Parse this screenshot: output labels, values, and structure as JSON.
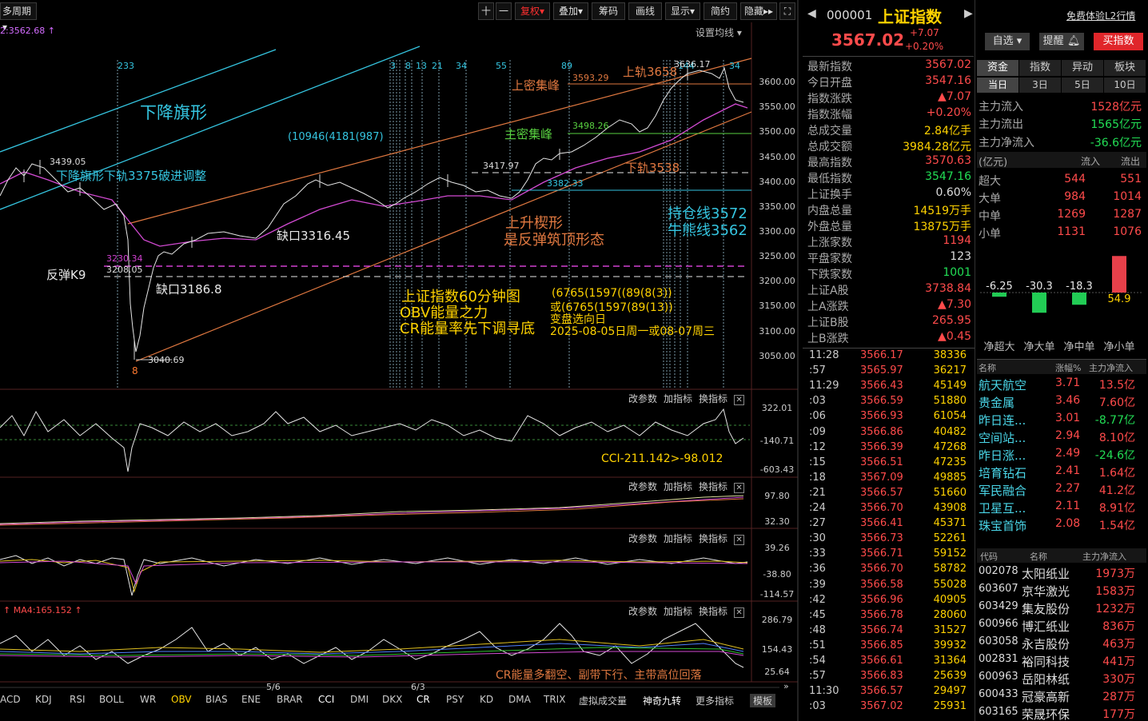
{
  "toolbar": {
    "period": "多周期",
    "tools": [
      "十",
      "一",
      "复权",
      "叠加",
      "筹码",
      "画线",
      "显示",
      "简约",
      "隐藏"
    ],
    "settings": "设置均线",
    "ma_line": "2:3562.68"
  },
  "chart": {
    "price_axis": [
      "3600.00",
      "3550.00",
      "3500.00",
      "3450.00",
      "3400.00",
      "3350.00",
      "3300.00",
      "3250.00",
      "3200.00",
      "3150.00",
      "3100.00",
      "3050.00"
    ],
    "top_numbers": [
      "233",
      "3",
      "8",
      "13",
      "21",
      "34",
      "55",
      "89",
      "144",
      "34"
    ],
    "annotations": {
      "desc_flag": "下降旗形",
      "flag_break": "下降旗形下轨3375破进调整",
      "fib_triple": "(10946(4181(987)",
      "high_3439": "3439.05",
      "upper_peak": "上密集峰",
      "mid_peak": "主密集峰",
      "p3593": "3593.29",
      "p3498": "3498.26",
      "upper_rail": "上轨3658",
      "lower_rail": "下轨3538",
      "p3636": "3636.17",
      "p3417": "3417.97",
      "p3382": "3382.33",
      "wedge1": "上升楔形",
      "wedge2": "是反弹筑顶形态",
      "hold_line": "持仓线3572",
      "bull_bear": "牛熊线3562",
      "gap1": "缺口3316.45",
      "gap2": "缺口3186.8",
      "p3230": "3230.34",
      "p3208": "3208.05",
      "k9": "反弹K9",
      "low_3040": "3040.69",
      "low_digit": "8",
      "title1": "上证指数60分钟图",
      "title2": "OBV能量之力",
      "title3": "CR能量率先下调寻底",
      "seq1": "(6765(1597((89(8(3))",
      "seq2": "或(6765(1597(89(13))",
      "seq3": "变盘选向日",
      "seq4": "2025-08-05日周一或08-07周三",
      "cci_val": "CCI-211.142>-98.012",
      "cr_note": "CR能量多翻空、副带下行、主带高位回落",
      "ma4": "MA4:165.152"
    },
    "sub1_axis": [
      "322.01",
      "-140.71",
      "-603.43"
    ],
    "sub2_axis": [
      "97.80",
      "32.30"
    ],
    "sub3_axis": [
      "39.26",
      "-38.80",
      "-114.57"
    ],
    "sub4_axis": [
      "286.79",
      "154.43",
      "25.64"
    ],
    "sub_tools": [
      "改参数",
      "加指标",
      "换指标"
    ],
    "dates": [
      "5/6",
      "6/3"
    ],
    "bottom_tabs": [
      "ACD",
      "KDJ",
      "RSI",
      "BOLL",
      "WR",
      "OBV",
      "BIAS",
      "ENE",
      "BRAR",
      "CCI",
      "DMI",
      "DKX",
      "CR",
      "PSY",
      "KD",
      "DMA",
      "TRIX",
      "虚拟成交量",
      "神奇九转",
      "更多指标",
      "模板"
    ]
  },
  "quote": {
    "code": "000001",
    "name": "上证指数",
    "promo": "免费体验L2行情",
    "price": "3567.02",
    "change": "+7.07",
    "pct": "+0.20%",
    "btn_fav": "自选",
    "btn_alert": "提醒",
    "btn_buy": "买指数",
    "stats": [
      [
        "最新指数",
        "3567.02"
      ],
      [
        "今日开盘",
        "3547.16"
      ],
      [
        "指数涨跌",
        "▲7.07"
      ],
      [
        "指数涨幅",
        "+0.20%"
      ],
      [
        "总成交量",
        "2.84亿手"
      ],
      [
        "总成交额",
        "3984.28亿元"
      ],
      [
        "最高指数",
        "3570.63"
      ],
      [
        "最低指数",
        "3547.16"
      ],
      [
        "上证换手",
        "0.60%"
      ],
      [
        "内盘总量",
        "14519万手"
      ],
      [
        "外盘总量",
        "13875万手"
      ],
      [
        "上涨家数",
        "1194"
      ],
      [
        "平盘家数",
        "123"
      ],
      [
        "下跌家数",
        "1001"
      ],
      [
        "上证A股",
        "3738.84"
      ],
      [
        "上A涨跌",
        "▲7.30"
      ],
      [
        "上证B股",
        "265.95"
      ],
      [
        "上B涨跌",
        "▲0.45"
      ]
    ],
    "ticks": [
      [
        "11:28",
        "3566.17",
        "38336"
      ],
      [
        ":57",
        "3565.97",
        "36217"
      ],
      [
        "11:29",
        "3566.43",
        "45149"
      ],
      [
        ":03",
        "3566.59",
        "51880"
      ],
      [
        ":06",
        "3566.93",
        "61054"
      ],
      [
        ":09",
        "3566.86",
        "40482"
      ],
      [
        ":12",
        "3566.39",
        "47268"
      ],
      [
        ":15",
        "3566.51",
        "47235"
      ],
      [
        ":18",
        "3567.09",
        "49885"
      ],
      [
        ":21",
        "3566.57",
        "51660"
      ],
      [
        ":24",
        "3566.70",
        "43908"
      ],
      [
        ":27",
        "3566.41",
        "45371"
      ],
      [
        ":30",
        "3566.73",
        "52261"
      ],
      [
        ":33",
        "3566.71",
        "59152"
      ],
      [
        ":36",
        "3566.70",
        "58782"
      ],
      [
        ":39",
        "3566.58",
        "55028"
      ],
      [
        ":42",
        "3566.96",
        "40905"
      ],
      [
        ":45",
        "3566.78",
        "28060"
      ],
      [
        ":48",
        "3566.74",
        "31527"
      ],
      [
        ":51",
        "3566.85",
        "39932"
      ],
      [
        ":54",
        "3566.61",
        "31364"
      ],
      [
        ":57",
        "3566.83",
        "25639"
      ],
      [
        "11:30",
        "3566.57",
        "29497"
      ],
      [
        ":03",
        "3567.02",
        "25931"
      ]
    ]
  },
  "fund": {
    "tabs": [
      "资金",
      "指数",
      "异动",
      "板块"
    ],
    "subtabs": [
      "当日",
      "3日",
      "5日",
      "10日"
    ],
    "flows": [
      [
        "主力流入",
        "1528亿元"
      ],
      [
        "主力流出",
        "1565亿元"
      ],
      [
        "主力净流入",
        "-36.6亿元"
      ]
    ],
    "table_head": [
      "(亿元)",
      "流入",
      "流出"
    ],
    "table": [
      [
        "超大",
        "544",
        "551"
      ],
      [
        "大单",
        "984",
        "1014"
      ],
      [
        "中单",
        "1269",
        "1287"
      ],
      [
        "小单",
        "1131",
        "1076"
      ]
    ],
    "bars": [
      {
        "label": "净超大",
        "value": -6.25
      },
      {
        "label": "净大单",
        "value": -30.3
      },
      {
        "label": "净中单",
        "value": -18.3
      },
      {
        "label": "净小单",
        "value": 54.9
      }
    ],
    "bar_texts": [
      "-6.25",
      "-30.3",
      "-18.3",
      "54.9"
    ],
    "sector_head": [
      "名称",
      "涨幅%",
      "主力净流入"
    ],
    "sectors": [
      [
        "航天航空",
        "3.71",
        "13.5亿"
      ],
      [
        "贵金属",
        "3.46",
        "7.60亿"
      ],
      [
        "昨日连...",
        "3.01",
        "-8.77亿"
      ],
      [
        "空间站...",
        "2.94",
        "8.10亿"
      ],
      [
        "昨日涨...",
        "2.49",
        "-24.6亿"
      ],
      [
        "培育钻石",
        "2.41",
        "1.64亿"
      ],
      [
        "军民融合",
        "2.27",
        "41.2亿"
      ],
      [
        "卫星互...",
        "2.11",
        "8.91亿"
      ],
      [
        "珠宝首饰",
        "2.08",
        "1.54亿"
      ]
    ],
    "stock_head": [
      "代码",
      "名称",
      "主力净流入"
    ],
    "stocks": [
      [
        "002078",
        "太阳纸业",
        "1973万"
      ],
      [
        "603607",
        "京华激光",
        "1583万"
      ],
      [
        "603429",
        "集友股份",
        "1232万"
      ],
      [
        "600966",
        "博汇纸业",
        "836万"
      ],
      [
        "603058",
        "永吉股份",
        "463万"
      ],
      [
        "002831",
        "裕同科技",
        "441万"
      ],
      [
        "600963",
        "岳阳林纸",
        "330万"
      ],
      [
        "600433",
        "冠豪高新",
        "287万"
      ],
      [
        "603165",
        "荣晟环保",
        "177万"
      ]
    ]
  }
}
